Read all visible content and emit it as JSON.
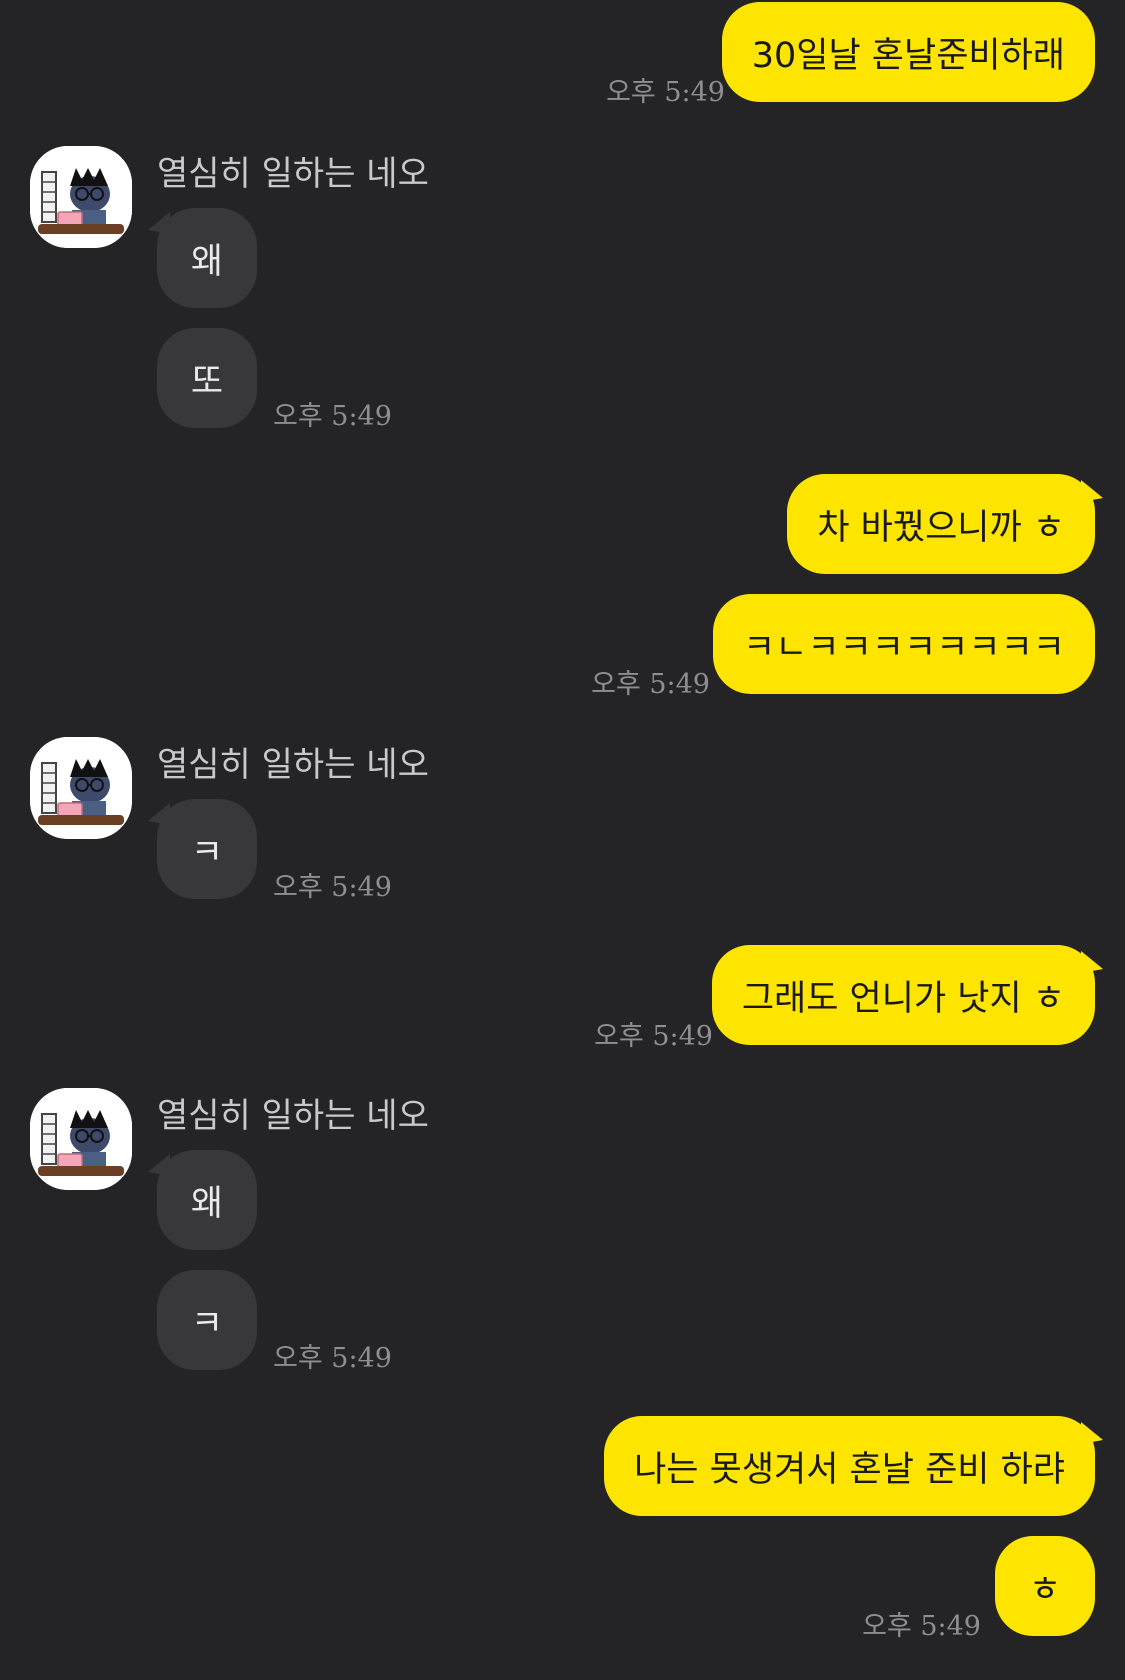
{
  "conversation": {
    "sender_name": "열심히 일하는 네오",
    "avatar_icon": "neo-working-avatar-icon",
    "colors": {
      "background": "#242427",
      "my_bubble": "#fee500",
      "their_bubble": "#38383c",
      "timestamp": "#8e8e93"
    },
    "messages": [
      {
        "from": "me",
        "text": "30일날 혼날준비하래",
        "time": "오후 5:49"
      },
      {
        "from": "them",
        "text": "왜"
      },
      {
        "from": "them",
        "text": "또",
        "time": "오후 5:49"
      },
      {
        "from": "me",
        "text": "차 바꿨으니까 ㅎ"
      },
      {
        "from": "me",
        "text": "ㅋㄴㅋㅋㅋㅋㅋㅋㅋㅋ",
        "time": "오후 5:49"
      },
      {
        "from": "them",
        "text": "ㅋ",
        "time": "오후 5:49"
      },
      {
        "from": "me",
        "text": "그래도 언니가 낫지 ㅎ",
        "time": "오후 5:49"
      },
      {
        "from": "them",
        "text": "왜"
      },
      {
        "from": "them",
        "text": "ㅋ",
        "time": "오후 5:49"
      },
      {
        "from": "me",
        "text": "나는 못생겨서 혼날 준비 하랴"
      },
      {
        "from": "me",
        "text": "ㅎ",
        "time": "오후 5:49"
      }
    ]
  }
}
